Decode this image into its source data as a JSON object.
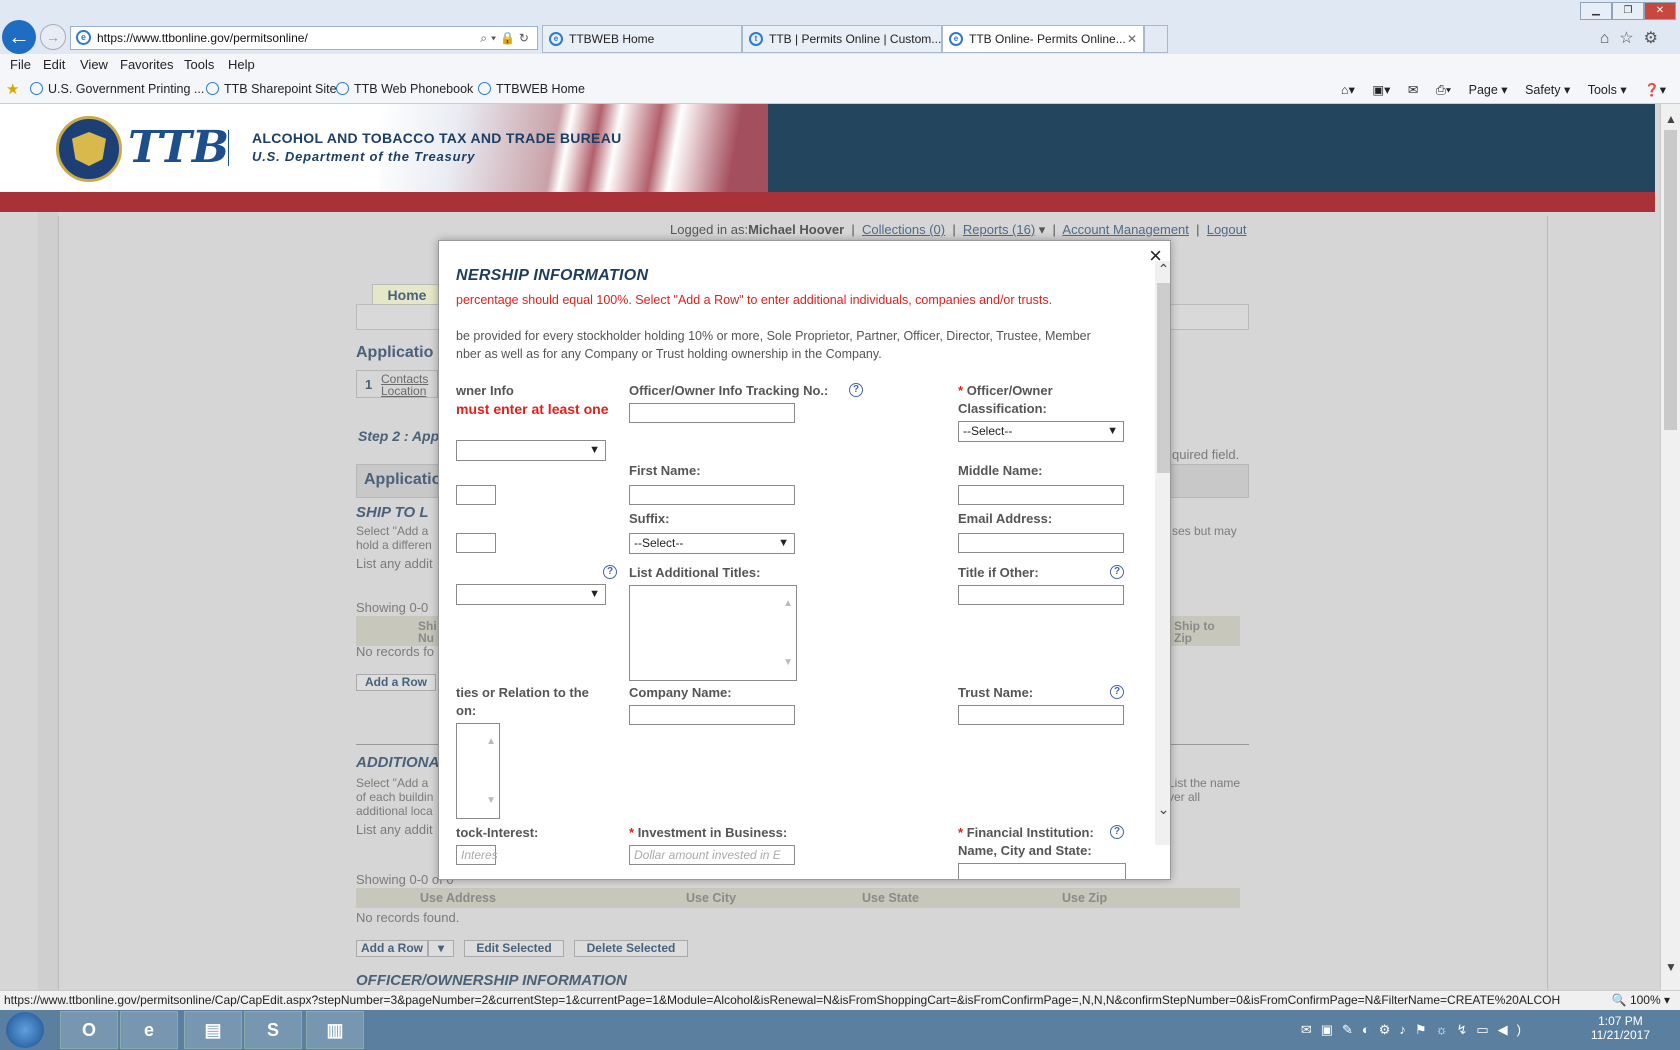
{
  "browser": {
    "address": "https://www.ttbonline.gov/permitsonline/",
    "tabs": [
      {
        "label": "TTBWEB Home"
      },
      {
        "label": "TTB | Permits Online | Custom..."
      },
      {
        "label": "TTB Online- Permits Online..."
      }
    ],
    "menu": [
      "File",
      "Edit",
      "View",
      "Favorites",
      "Tools",
      "Help"
    ],
    "favorites": [
      "U.S. Government Printing ...",
      "TTB Sharepoint Site",
      "TTB Web Phonebook",
      "TTBWEB Home"
    ],
    "commands": [
      "Page ▾",
      "Safety ▾",
      "Tools ▾"
    ],
    "status_url": "https://www.ttbonline.gov/permitsonline/Cap/CapEdit.aspx?stepNumber=3&pageNumber=2&currentStep=1&currentPage=1&Module=Alcohol&isRenewal=N&isFromShoppingCart=&isFromConfirmPage=,N,N,N&confirmStepNumber=0&isFromConfirmPage=N&FilterName=CREATE%20ALCOH",
    "zoom": "100%"
  },
  "header": {
    "logo_text": "TTB",
    "agency": "ALCOHOL AND TOBACCO TAX AND TRADE BUREAU",
    "department": "U.S. Department of the Treasury"
  },
  "account": {
    "logged_in_label": "Logged in as:",
    "user": "Michael Hoover",
    "collections": "Collections (0)",
    "reports": "Reports (16)",
    "account_mgmt": "Account Management",
    "logout": "Logout"
  },
  "page": {
    "home_tab": "Home",
    "application_heading": "Applicatio",
    "step_number": "1",
    "step_label_1": "Contacts",
    "step_label_2": "Location",
    "step2": "Step 2 : App",
    "required_note": "quired field.",
    "app_bar": "Applicatio",
    "ship_to": "SHIP TO L",
    "ship_text1": "Select \"Add a",
    "ship_text1_right": "ses but may",
    "ship_text2": "hold a differen",
    "ship_text3": "List any addit",
    "showing1": "Showing 0-0",
    "grid1_col1": "Shi",
    "grid1_col1b": "Nu",
    "grid1_col_right": "Ship to",
    "grid1_col_right2": "Zip",
    "no_records1": "No records fo",
    "add_row1": "Add a Row",
    "additional": "ADDITIONA",
    "addl_text1": "Select \"Add a",
    "addl_text1_right": "List the name",
    "addl_text2": "of each buildin",
    "addl_text2_right": "ver all",
    "addl_text3": "additional loca",
    "addl_text4": "List any addit",
    "showing2": "Showing 0-0 of 0",
    "grid2_cols": [
      "Use Address",
      "Use City",
      "Use State",
      "Use Zip"
    ],
    "no_records2": "No records found.",
    "add_row2": "Add a Row",
    "edit_selected": "Edit Selected",
    "delete_selected": "Delete Selected",
    "officer_heading": "OFFICER/OWNERSHIP INFORMATION"
  },
  "modal": {
    "close": "×",
    "title": "NERSHIP INFORMATION",
    "red_note": "percentage should equal 100%. Select \"Add a Row\" to enter additional individuals, companies and/or trusts.",
    "note_line1": "be provided for every stockholder holding 10% or more, Sole Proprietor, Partner, Officer, Director, Trustee, Member",
    "note_line2": "nber as well as for any Company or Trust holding ownership in the Company.",
    "owner_info_label": "wner Info",
    "must_enter": "must enter at least one",
    "tracking_label": "Officer/Owner Info Tracking No.:",
    "classification_label_1": "Officer/Owner",
    "classification_label_2": "Classification:",
    "classification_value": "--Select--",
    "first_name_label": "First Name:",
    "middle_name_label": "Middle Name:",
    "suffix_label": "Suffix:",
    "suffix_value": "--Select--",
    "email_label": "Email Address:",
    "additional_titles_label": "List Additional Titles:",
    "title_other_label": "Title if Other:",
    "duties_label_1": "ties or Relation to the",
    "duties_label_2": "on:",
    "company_label": "Company Name:",
    "trust_label": "Trust Name:",
    "stock_label": "tock-Interest:",
    "stock_placeholder": "Interes",
    "investment_label": "Investment in Business:",
    "investment_placeholder": "Dollar amount invested in E",
    "financial_label_1": "Financial Institution:",
    "financial_label_2": "Name, City and State:",
    "required_mark": "*",
    "help_mark": "?"
  },
  "taskbar": {
    "time": "1:07 PM",
    "date": "11/21/2017"
  }
}
